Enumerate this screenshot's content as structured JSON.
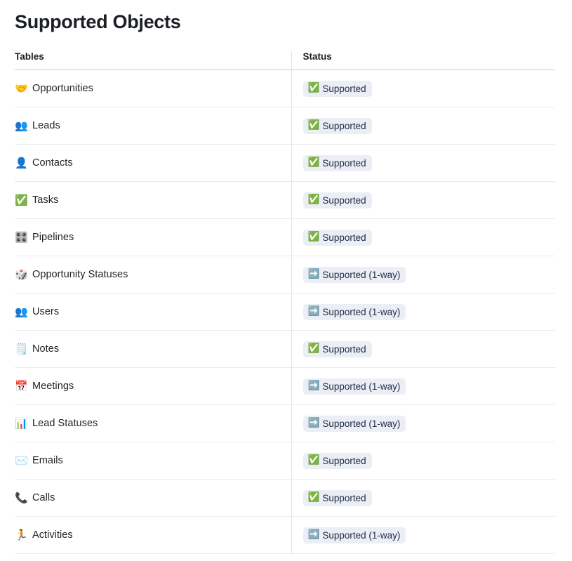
{
  "page": {
    "title": "Supported Objects"
  },
  "colors": {
    "badge_background": "#eceef5",
    "badge_text": "#1c2b45",
    "header_rule": "#c9ccd1",
    "row_rule": "#e8eaec",
    "column_divider": "#e2e4e8",
    "title_text": "#1b1f23",
    "body_text": "#1f2328"
  },
  "table": {
    "columns": [
      {
        "key": "tables",
        "label": "Tables"
      },
      {
        "key": "status",
        "label": "Status"
      }
    ],
    "rows": [
      {
        "icon": "handshake-icon",
        "icon_glyph": "🤝",
        "name": "Opportunities",
        "status_icon": "check-mark-button-icon",
        "status_glyph": "✅",
        "status": "Supported"
      },
      {
        "icon": "busts-in-silhouette-icon",
        "icon_glyph": "👥",
        "name": "Leads",
        "status_icon": "check-mark-button-icon",
        "status_glyph": "✅",
        "status": "Supported"
      },
      {
        "icon": "bust-in-silhouette-icon",
        "icon_glyph": "👤",
        "name": "Contacts",
        "status_icon": "check-mark-button-icon",
        "status_glyph": "✅",
        "status": "Supported"
      },
      {
        "icon": "check-mark-button-icon",
        "icon_glyph": "✅",
        "name": "Tasks",
        "status_icon": "check-mark-button-icon",
        "status_glyph": "✅",
        "status": "Supported"
      },
      {
        "icon": "control-knobs-icon",
        "icon_glyph": "🎛️",
        "name": "Pipelines",
        "status_icon": "check-mark-button-icon",
        "status_glyph": "✅",
        "status": "Supported"
      },
      {
        "icon": "game-die-icon",
        "icon_glyph": "🎲",
        "name": "Opportunity Statuses",
        "status_icon": "right-arrow-icon",
        "status_glyph": "➡️",
        "status": "Supported (1-way)"
      },
      {
        "icon": "busts-in-silhouette-icon",
        "icon_glyph": "👥",
        "name": "Users",
        "status_icon": "right-arrow-icon",
        "status_glyph": "➡️",
        "status": "Supported (1-way)"
      },
      {
        "icon": "spiral-notepad-icon",
        "icon_glyph": "🗒️",
        "name": "Notes",
        "status_icon": "check-mark-button-icon",
        "status_glyph": "✅",
        "status": "Supported"
      },
      {
        "icon": "calendar-icon",
        "icon_glyph": "📅",
        "name": "Meetings",
        "status_icon": "right-arrow-icon",
        "status_glyph": "➡️",
        "status": "Supported (1-way)"
      },
      {
        "icon": "bar-chart-icon",
        "icon_glyph": "📊",
        "name": "Lead Statuses",
        "status_icon": "right-arrow-icon",
        "status_glyph": "➡️",
        "status": "Supported (1-way)"
      },
      {
        "icon": "envelope-icon",
        "icon_glyph": "✉️",
        "name": "Emails",
        "status_icon": "check-mark-button-icon",
        "status_glyph": "✅",
        "status": "Supported"
      },
      {
        "icon": "telephone-receiver-icon",
        "icon_glyph": "📞",
        "name": "Calls",
        "status_icon": "check-mark-button-icon",
        "status_glyph": "✅",
        "status": "Supported"
      },
      {
        "icon": "runner-icon",
        "icon_glyph": "🏃",
        "name": "Activities",
        "status_icon": "right-arrow-icon",
        "status_glyph": "➡️",
        "status": "Supported (1-way)"
      }
    ]
  }
}
